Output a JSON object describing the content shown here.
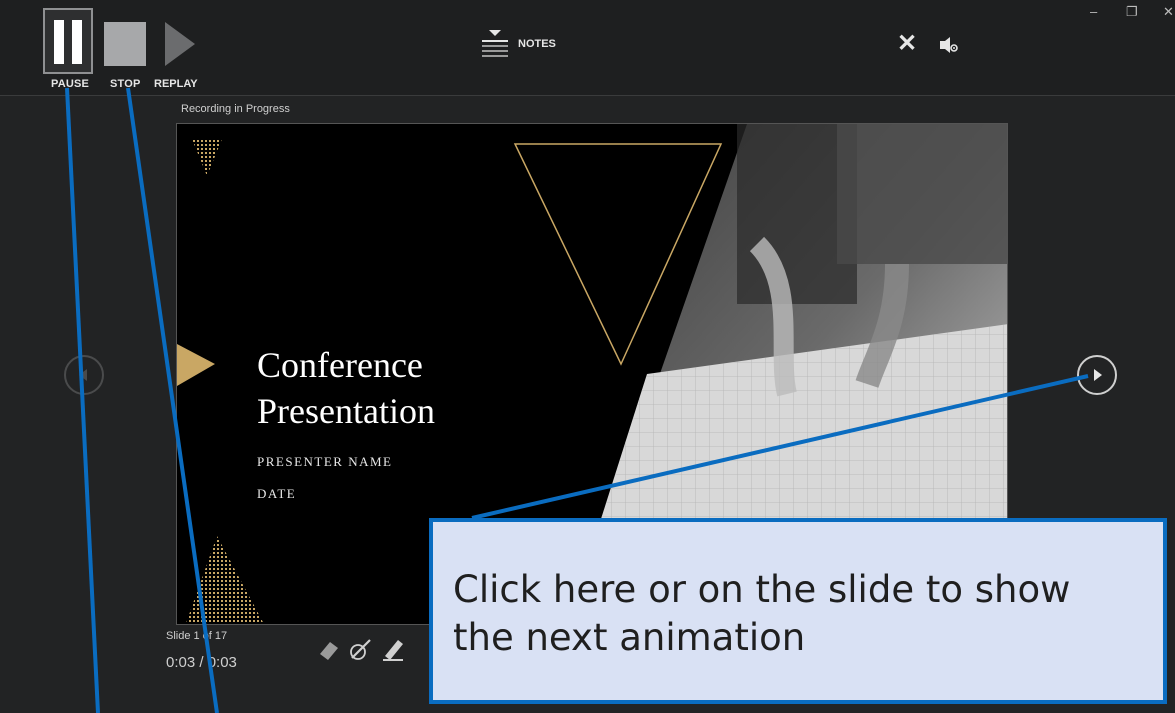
{
  "toolbar": {
    "pause_label": "PAUSE",
    "stop_label": "STOP",
    "replay_label": "REPLAY",
    "notes_label": "NOTES"
  },
  "status": {
    "recording": "Recording in Progress"
  },
  "slide": {
    "title_line1": "Conference",
    "title_line2": "Presentation",
    "presenter": "PRESENTER NAME",
    "date": "DATE"
  },
  "footer": {
    "slide_counter": "Slide 1 of 17",
    "timer": "0:03 / 0:03"
  },
  "callout": {
    "text": "Click here or on the slide to show the next animation"
  },
  "colors": {
    "accent_gold": "#c9a764",
    "callout_border": "#0a6cc0",
    "callout_fill": "#d9e1f4"
  }
}
